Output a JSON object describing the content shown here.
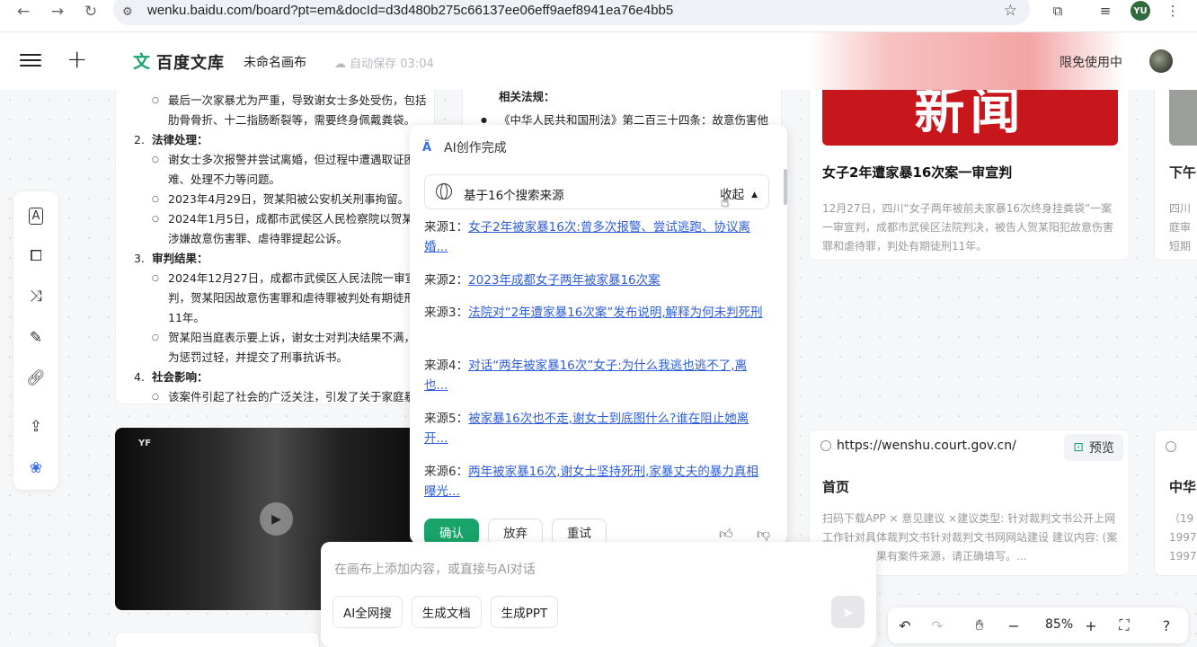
{
  "browser": {
    "url": "wenku.baidu.com/board?pt=em&docId=d3d480b275c66137ee06eff9aef8941ea76e4bb5",
    "profile_initials": "YU"
  },
  "header": {
    "logo_text": "百度文库",
    "doc_title": "未命名画布",
    "autosave": "自动保存 03:04",
    "free_use": "限免使用中"
  },
  "doc_card": {
    "lines": [
      "最后一次家暴尤为严重，导致谢女士多处受伤，包括",
      "肋骨骨折、十二指肠断裂等，需要终身佩戴粪袋。",
      "法律处理：",
      "谢女士多次报警并尝试离婚，但过程中遭遇取证困",
      "难、处理不力等问题。",
      "2023年4月29日，贺某阳被公安机关刑事拘留。",
      "2024年1月5日，成都市武侯区人民检察院以贺某阳",
      "涉嫌故意伤害罪、虐待罪提起公诉。",
      "审判结果：",
      "2024年12月27日，成都市武侯区人民法院一审宣",
      "判，贺某阳因故意伤害罪和虐待罪被判处有期徒刑",
      "11年。",
      "贺某阳当庭表示要上诉，谢女士对判决结果不满，认",
      "为惩罚过轻，并提交了刑事抗诉书。",
      "社会影响：",
      "该案件引起了社会的广泛关注，引发了关于家庭暴力"
    ],
    "num_2": "2.",
    "num_3": "3.",
    "num_4": "4."
  },
  "law_card": {
    "title": "相关法规：",
    "item": "《中华人民共和国刑法》第二百三十四条：故意伤害他"
  },
  "video": {
    "badge": "YF"
  },
  "news_card": {
    "image_text": "新闻",
    "title": "女子2年遭家暴16次案一审宣判",
    "desc": "12月27日，四川“女子两年被前夫家暴16次终身挂粪袋”一案一审宣判，成都市武侯区法院判决，被告人贺某阳犯故意伤害罪和虐待罪，判处有期徒刑11年。"
  },
  "news_card2": {
    "title": "下午",
    "desc_1": "四川",
    "desc_2": "庭审",
    "desc_3": "短期"
  },
  "link_card": {
    "url": "https://wenshu.court.gov.cn/",
    "preview": "预览",
    "title": "首页",
    "desc": "扫码下载APP × 意见建议 ×建议类型: 针对裁判文书公开上网工作针对具体裁判文书针对裁判文书网网站建设 建议内容: (案件来源：如果有案件来源，请正确填写。..."
  },
  "link_card2": {
    "title": "中华",
    "desc_1": "（19",
    "desc_2": "1997",
    "desc_3": "1997"
  },
  "ai_panel": {
    "title": "AI创作完成",
    "sources_label": "基于16个搜索来源",
    "collapse_label": "收起",
    "sources": [
      {
        "key": "来源1：",
        "text": "女子2年被家暴16次:曾多次报警、尝试逃跑、协议离婚..."
      },
      {
        "key": "来源2：",
        "text": "2023年成都女子两年被家暴16次案"
      },
      {
        "key": "来源3：",
        "text": "法院对“2年遭家暴16次案”发布说明,解释为何未判死刑"
      },
      {
        "key": "来源4：",
        "text": "对话“两年被家暴16次”女子:为什么我逃也逃不了,离也..."
      },
      {
        "key": "来源5：",
        "text": "被家暴16次也不走,谢女士到底图什么?谁在阻止她离开..."
      },
      {
        "key": "来源6：",
        "text": "两年被家暴16次,谢女士坚持死刑,家暴丈夫的暴力真相曝光..."
      }
    ],
    "confirm": "确认",
    "discard": "放弃",
    "retry": "重试"
  },
  "chat": {
    "placeholder": "在画布上添加内容，或直接与AI对话",
    "chip_search": "AI全网搜",
    "chip_doc": "生成文档",
    "chip_ppt": "生成PPT"
  },
  "zoom": {
    "level": "85%"
  }
}
